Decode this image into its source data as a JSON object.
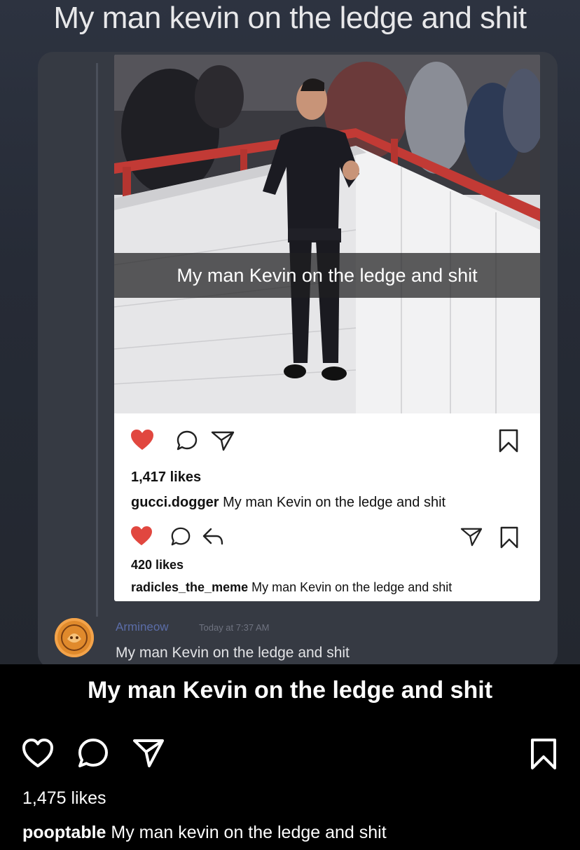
{
  "meme": {
    "top_caption": "My man kevin on the ledge and shit",
    "inner_post": {
      "photo_caption": "My man Kevin on the ledge and shit",
      "post1": {
        "likes": "1,417 likes",
        "username": "gucci.dogger",
        "caption": "My man Kevin on the ledge and shit"
      },
      "post2": {
        "likes": "420 likes",
        "username": "radicles_the_meme",
        "caption": "My man Kevin on the ledge and shit"
      }
    },
    "discord": {
      "username": "Armineow",
      "timestamp": "Today at 7:37 AM",
      "message": "My man Kevin on the ledge and shit"
    }
  },
  "post": {
    "overlay_caption": "My man Kevin on the ledge and shit",
    "likes": "1,475 likes",
    "username": "pooptable",
    "caption": "My man kevin on the ledge and shit",
    "actions": [
      "heart-icon",
      "comment-icon",
      "share-icon",
      "bookmark-icon"
    ]
  },
  "colors": {
    "like_red": "#e1473f",
    "discord_name": "#5b6da8",
    "background": "#000000"
  }
}
